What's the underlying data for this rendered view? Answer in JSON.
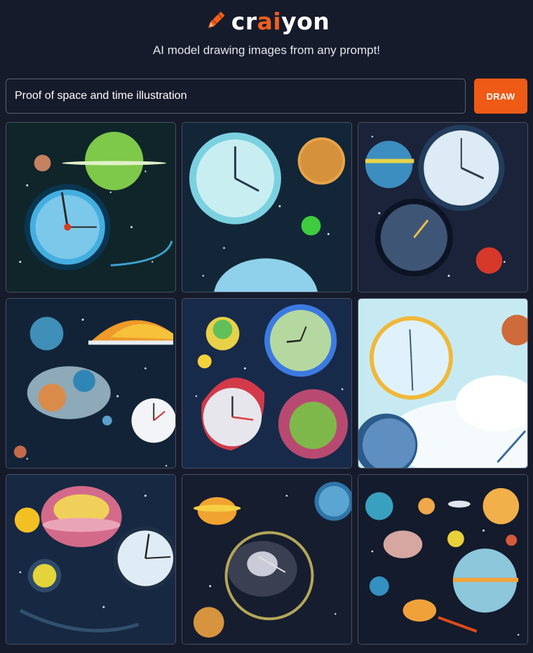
{
  "brand": {
    "name_prefix": "cr",
    "name_accent": "ai",
    "name_suffix": "yon",
    "tagline": "AI model drawing images from any prompt!",
    "accent_color": "#f0601e",
    "logo_icon": "crayon-icon"
  },
  "prompt": {
    "value": "Proof of space and time illustration"
  },
  "draw_button": {
    "label": "DRAW",
    "color": "#ef5a16"
  },
  "results": {
    "count": 9,
    "images": [
      {
        "subject": "clock and green planet"
      },
      {
        "subject": "clock with orange planet"
      },
      {
        "subject": "two clocks and red planet"
      },
      {
        "subject": "half planet and clock"
      },
      {
        "subject": "clocks and planets"
      },
      {
        "subject": "clock in light sky"
      },
      {
        "subject": "pink planet and clock"
      },
      {
        "subject": "galaxy ring with planets"
      },
      {
        "subject": "planets and clock globe"
      }
    ]
  }
}
